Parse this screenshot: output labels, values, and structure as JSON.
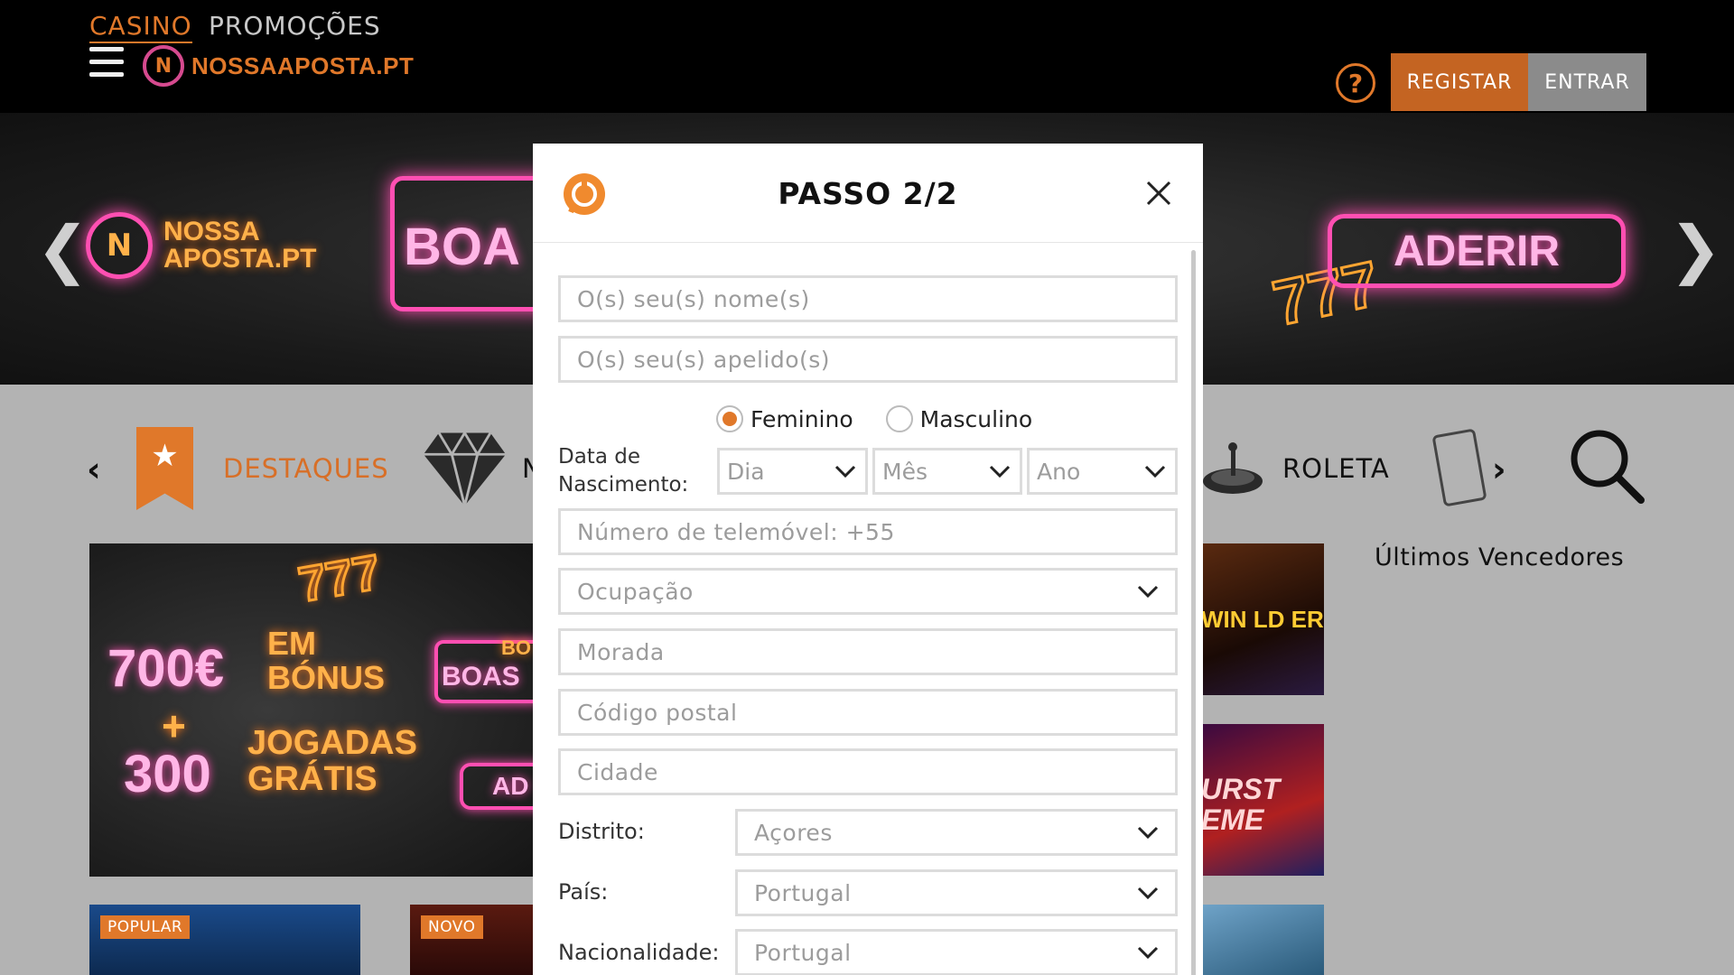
{
  "nav": {
    "casino": "CASINO",
    "promocoes": "PROMOÇÕES"
  },
  "logo": {
    "text": "NOSSAAPOSTA.PT",
    "mark": "N"
  },
  "header": {
    "help": "?",
    "registar": "REGISTAR",
    "entrar": "ENTRAR"
  },
  "banner": {
    "logo_line1": "NOSSA",
    "logo_line2": "APOSTA.PT",
    "boa": "BOA",
    "aderir": "ADERIR",
    "sevens": "777",
    "left_arrow": "❮",
    "right_arrow": "❯"
  },
  "categories": {
    "left_arrow": "‹",
    "right_arrow": "›",
    "destaques": "DESTAQUES",
    "n_partial": "N",
    "roleta": "ROLETA"
  },
  "winners_title": "Últimos Vencedores",
  "promo": {
    "amount": "700€",
    "em": "EM",
    "bonus": "BÓNUS",
    "plus": "+",
    "spins": "300",
    "jogadas": "JOGADAS",
    "gratis": "GRÁTIS",
    "sevens": "777",
    "bo": "BO",
    "boas": "BOAS",
    "ad": "AD"
  },
  "games": {
    "badge_popular": "POPULAR",
    "badge_novo": "NOVO",
    "tile1_text": "WIN LD ER",
    "tile2_text": "URST EME"
  },
  "modal": {
    "title": "PASSO 2/2",
    "first_name_placeholder": "O(s) seu(s) nome(s)",
    "last_name_placeholder": "O(s) seu(s) apelido(s)",
    "gender_female": "Feminino",
    "gender_male": "Masculino",
    "dob_label_line1": "Data de",
    "dob_label_line2": "Nascimento:",
    "dob_day": "Dia",
    "dob_month": "Mês",
    "dob_year": "Ano",
    "phone_placeholder": "Número de telemóvel: +55",
    "occupation": "Ocupação",
    "address_placeholder": "Morada",
    "postal_placeholder": "Código postal",
    "city_placeholder": "Cidade",
    "district_label": "Distrito:",
    "district_value": "Açores",
    "country_label": "País:",
    "country_value": "Portugal",
    "nationality_label": "Nacionalidade:",
    "nationality_value": "Portugal"
  },
  "colors": {
    "accent": "#e0782a",
    "neon_pink": "#ff4fb2",
    "black": "#000000"
  },
  "icons": [
    "hamburger-icon",
    "help-icon",
    "star-bookmark-icon",
    "diamond-icon",
    "roulette-icon",
    "cards-icon",
    "search-icon",
    "chat-icon",
    "close-icon",
    "chevron-down-icon"
  ]
}
